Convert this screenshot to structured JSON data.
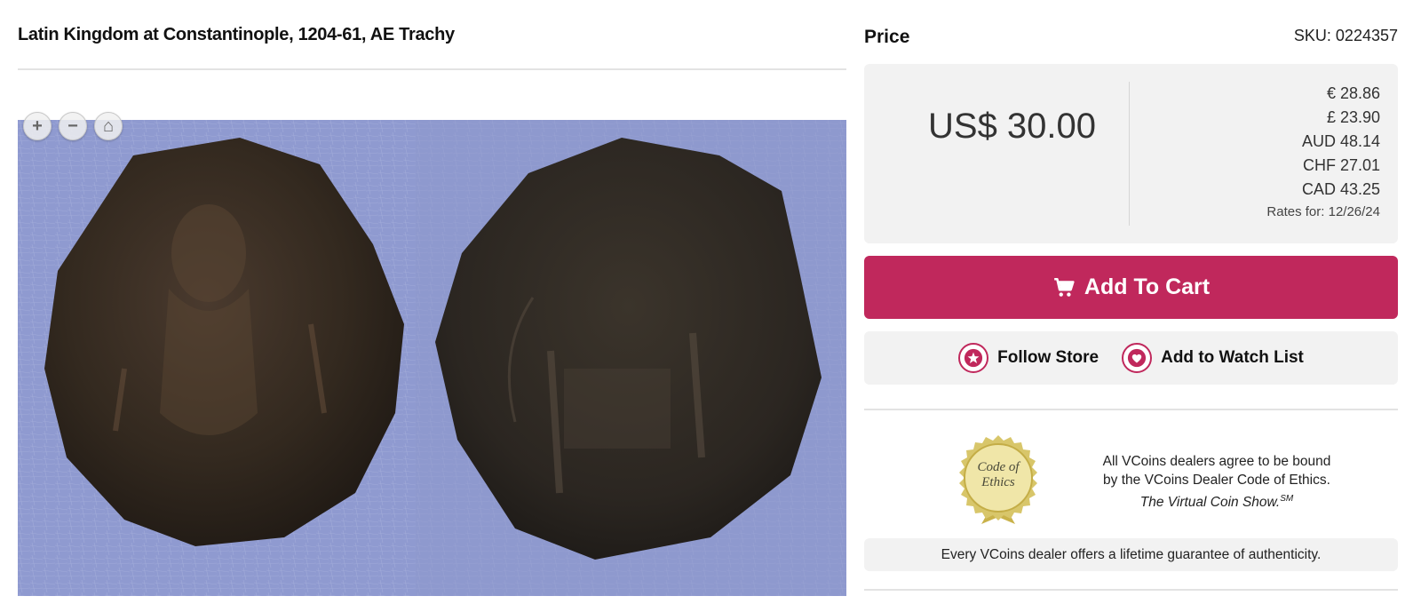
{
  "product": {
    "title": "Latin Kingdom at Constantinople, 1204-61, AE Trachy"
  },
  "gallery": {
    "zoom_in": "+",
    "zoom_out": "−",
    "home": "⌂"
  },
  "price": {
    "heading": "Price",
    "sku": "SKU: 0224357",
    "main": "US$ 30.00",
    "rates": [
      "€ 28.86",
      "£ 23.90",
      "AUD 48.14",
      "CHF 27.01",
      "CAD 43.25"
    ],
    "rates_date": "Rates for: 12/26/24"
  },
  "actions": {
    "add_to_cart": "Add To Cart",
    "follow_store": "Follow Store",
    "watch_list": "Add to Watch List"
  },
  "ethics": {
    "seal_line1": "Code of",
    "seal_line2": "Ethics",
    "line1": "All VCoins dealers agree to be bound",
    "line2": "by the VCoins Dealer Code of Ethics.",
    "show": "The Virtual Coin Show.",
    "show_mark": "SM",
    "guarantee": "Every VCoins dealer offers a lifetime guarantee of authenticity."
  },
  "colors": {
    "accent": "#c0285c",
    "panel": "#f2f2f2",
    "photo_background": "#8f9ad0",
    "seal_gold": "#d8c66a"
  }
}
